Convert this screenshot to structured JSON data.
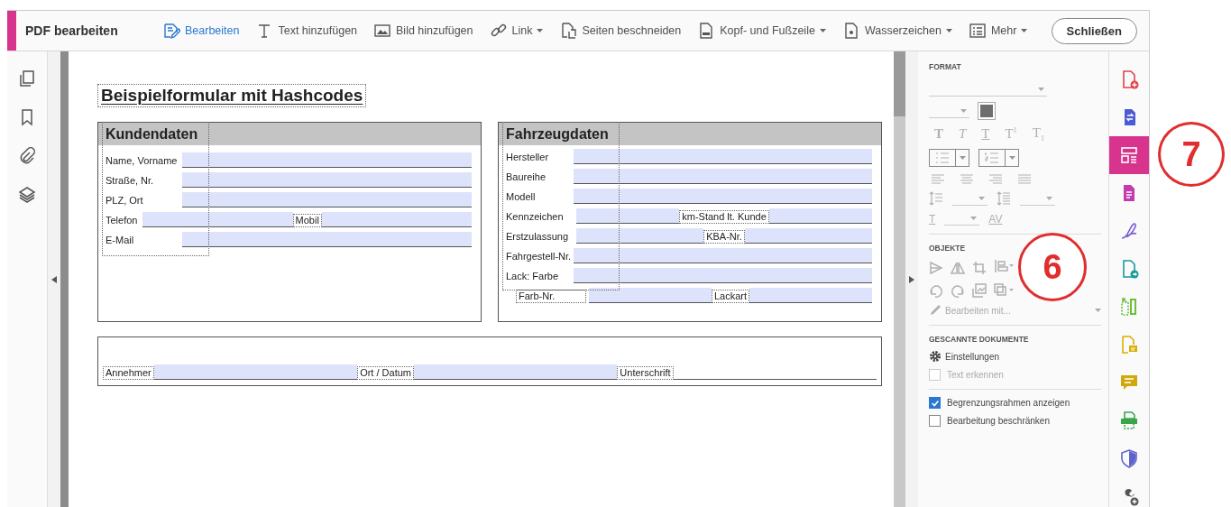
{
  "toolbar": {
    "title": "PDF bearbeiten",
    "tools": [
      {
        "kind": "edit",
        "label": "Bearbeiten",
        "selected": true,
        "dropdown": false
      },
      {
        "kind": "text",
        "label": "Text hinzufügen",
        "selected": false,
        "dropdown": false
      },
      {
        "kind": "image",
        "label": "Bild hinzufügen",
        "selected": false,
        "dropdown": false
      },
      {
        "kind": "link",
        "label": "Link",
        "selected": false,
        "dropdown": true
      },
      {
        "kind": "crop",
        "label": "Seiten beschneiden",
        "selected": false,
        "dropdown": false
      },
      {
        "kind": "header",
        "label": "Kopf- und Fußzeile",
        "selected": false,
        "dropdown": true
      },
      {
        "kind": "watermark",
        "label": "Wasserzeichen",
        "selected": false,
        "dropdown": true
      },
      {
        "kind": "more",
        "label": "Mehr",
        "selected": false,
        "dropdown": true
      }
    ],
    "close_button": "Schließen"
  },
  "document": {
    "title": "Beispielformular mit Hashcodes",
    "sections": [
      {
        "heading": "Kundendaten",
        "rows": [
          [
            {
              "label": "Name, Vorname",
              "kind": "input"
            }
          ],
          [
            {
              "label": "Straße, Nr.",
              "kind": "input"
            }
          ],
          [
            {
              "label": "PLZ, Ort",
              "kind": "input"
            }
          ],
          [
            {
              "label": "Telefon",
              "kind": "input"
            },
            {
              "label": "Mobil",
              "kind": "input",
              "boxed": true
            }
          ],
          [
            {
              "label": "E-Mail",
              "kind": "input"
            }
          ]
        ]
      },
      {
        "heading": "Fahrzeugdaten",
        "rows": [
          [
            {
              "label": "Hersteller",
              "kind": "input"
            }
          ],
          [
            {
              "label": "Baureihe",
              "kind": "input"
            }
          ],
          [
            {
              "label": "Modell",
              "kind": "input"
            }
          ],
          [
            {
              "label": "Kennzeichen",
              "kind": "input"
            },
            {
              "label": "km-Stand lt. Kunde",
              "kind": "input",
              "boxed": true
            }
          ],
          [
            {
              "label": "Erstzulassung",
              "kind": "input"
            },
            {
              "label": "KBA-Nr.",
              "kind": "input",
              "boxed": true
            }
          ],
          [
            {
              "label": "Fahrgestell-Nr.",
              "kind": "input"
            }
          ],
          [
            {
              "label": "Lack: Farbe",
              "kind": "input"
            }
          ],
          [
            {
              "label": "Farb-Nr.",
              "kind": "input",
              "boxed": true
            },
            {
              "label": "Lackart",
              "kind": "input",
              "boxed": true
            }
          ]
        ]
      }
    ],
    "footer_row": [
      {
        "label": "Annehmer",
        "kind": "input",
        "boxed": true
      },
      {
        "label": "Ort / Datum",
        "kind": "input",
        "boxed": true
      },
      {
        "label": "Unterschrift",
        "kind": "line",
        "boxed": true
      }
    ]
  },
  "properties_panel": {
    "format": {
      "heading": "FORMAT",
      "disabled": true,
      "text_styles": [
        {
          "kind": "bold",
          "glyph": "T"
        },
        {
          "kind": "italic",
          "glyph": "T"
        },
        {
          "kind": "underline",
          "glyph": "T"
        },
        {
          "kind": "superscript",
          "glyph": "T$^{1}$"
        },
        {
          "kind": "subscript",
          "glyph": "T$_{1}$"
        }
      ],
      "spacing_glyphs": [
        "T",
        "AV"
      ]
    },
    "objects": {
      "heading": "OBJEKTE",
      "disabled": true,
      "edit_with": "Bearbeiten mit..."
    },
    "scanned": {
      "heading": "GESCANNTE DOKUMENTE",
      "settings": "Einstellungen",
      "recognize": {
        "label": "Text erkennen",
        "checked": false,
        "disabled": true
      }
    },
    "options": [
      {
        "label": "Begrenzungsrahmen anzeigen",
        "checked": true,
        "disabled": false
      },
      {
        "label": "Bearbeitung beschränken",
        "checked": false,
        "disabled": false
      }
    ]
  },
  "right_rail": [
    {
      "kind": "doc-plus",
      "color": "#e0434a",
      "selected": false
    },
    {
      "kind": "doc-arrows",
      "color": "#4b5bd4",
      "selected": false
    },
    {
      "kind": "layout",
      "color": "#d8348e",
      "selected": true
    },
    {
      "kind": "doc-lines",
      "color": "#c43bb0",
      "selected": false
    },
    {
      "kind": "pen",
      "color": "#7b5cd6",
      "selected": false
    },
    {
      "kind": "doc-share",
      "color": "#179b9b",
      "selected": false
    },
    {
      "kind": "split",
      "color": "#6cc03a",
      "selected": false
    },
    {
      "kind": "doc-note",
      "color": "#d7b000",
      "selected": false
    },
    {
      "kind": "comment",
      "color": "#d1a80c",
      "selected": false
    },
    {
      "kind": "print",
      "color": "#3aa64a",
      "selected": false
    },
    {
      "kind": "shield",
      "color": "#5e62cc",
      "selected": false
    },
    {
      "kind": "wrench",
      "color": "#555555",
      "selected": false
    }
  ],
  "callouts": [
    {
      "number": "7"
    },
    {
      "number": "6"
    }
  ]
}
